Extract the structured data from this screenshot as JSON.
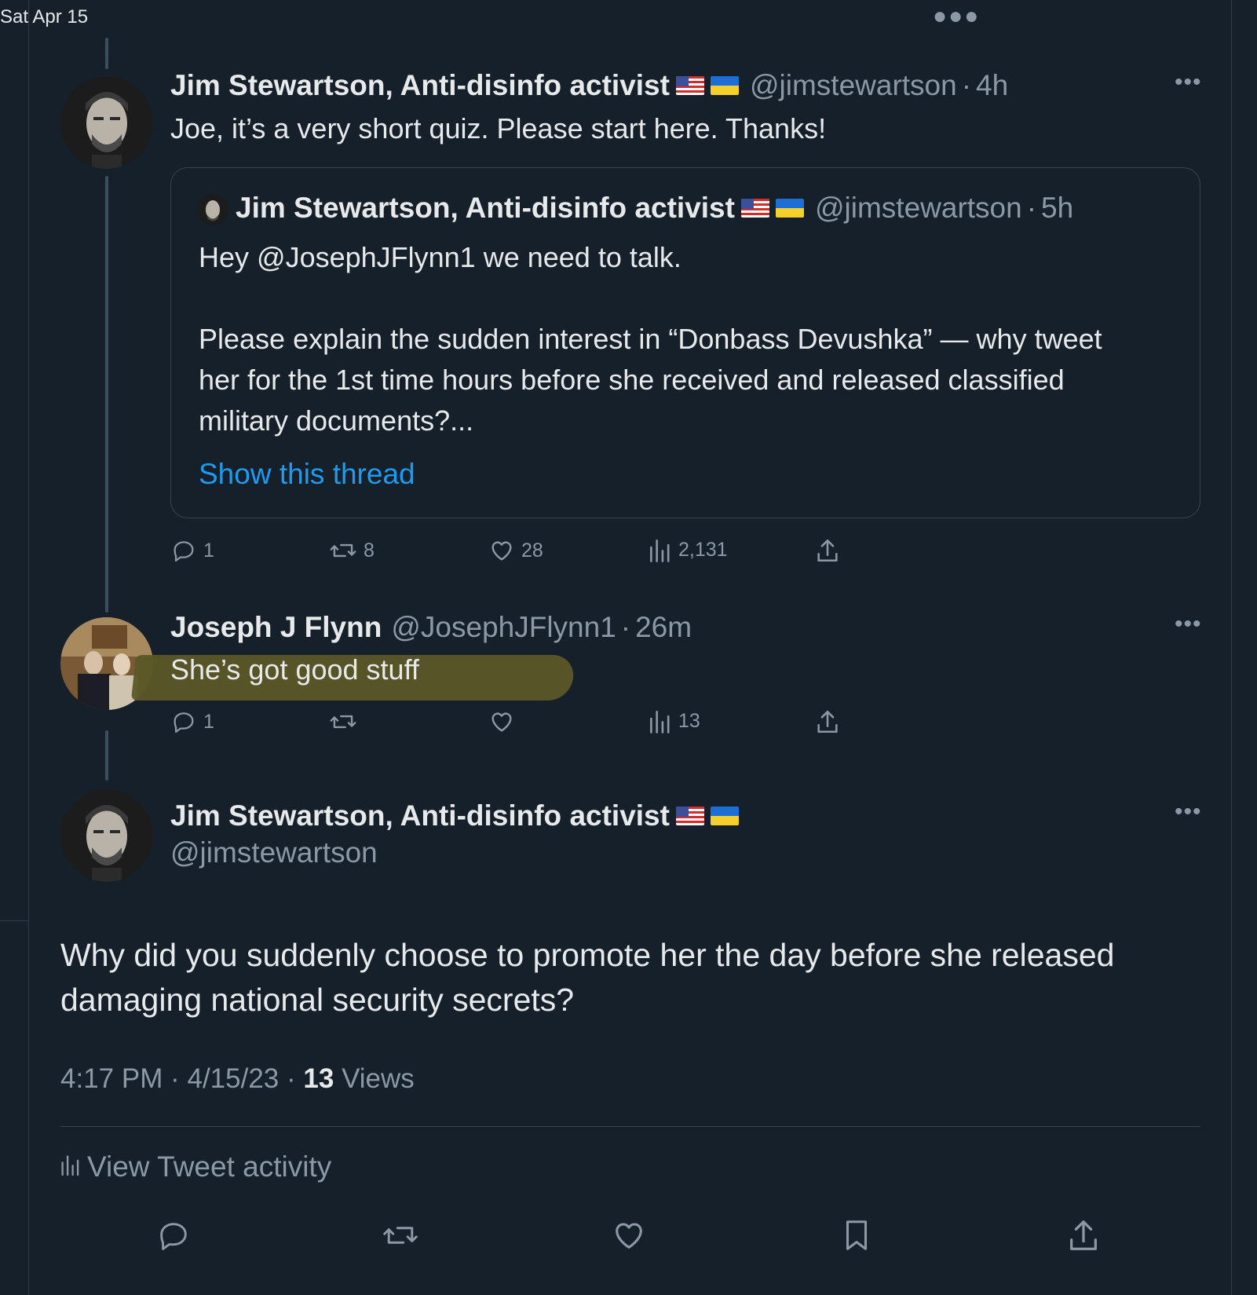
{
  "status": {
    "date": "Sat Apr 15"
  },
  "tweet1": {
    "name": "Jim Stewartson, Anti-disinfo activist",
    "handle": "@jimstewartson",
    "time": "4h",
    "text": "Joe, it’s a very short quiz. Please start here. Thanks!",
    "quote": {
      "name": "Jim Stewartson, Anti-disinfo activist",
      "handle": "@jimstewartson",
      "time": "5h",
      "line1": "Hey @JosephJFlynn1 we need to talk.",
      "line2": "Please explain the sudden interest in “Donbass Devushka” — why tweet",
      "line3": "her for the 1st time hours before she received and released classified",
      "line4": "military documents?...",
      "show_thread": "Show this thread"
    },
    "stats": {
      "replies": "1",
      "retweets": "8",
      "likes": "28",
      "views": "2,131"
    }
  },
  "tweet2": {
    "name": "Joseph J Flynn",
    "handle": "@JosephJFlynn1",
    "time": "26m",
    "text": "She’s got good stuff",
    "stats": {
      "replies": "1",
      "retweets": "",
      "likes": "",
      "views": "13"
    }
  },
  "tweet3": {
    "name": "Jim Stewartson, Anti-disinfo activist",
    "handle": "@jimstewartson",
    "text": "Why did you suddenly choose to promote her the day before she released damaging national security secrets?",
    "time": "4:17 PM",
    "date": "4/15/23",
    "views_count": "13",
    "views_label": "Views",
    "activity": "View Tweet activity"
  },
  "icons": {
    "reply": "reply-icon",
    "retweet": "retweet-icon",
    "like": "heart-icon",
    "views": "views-icon",
    "share": "share-icon",
    "bookmark": "bookmark-icon",
    "more": "more-icon"
  },
  "colors": {
    "background": "#15202b",
    "link": "#1d9bf0",
    "secondary": "#8b98a5",
    "highlight": "#5b5828"
  }
}
